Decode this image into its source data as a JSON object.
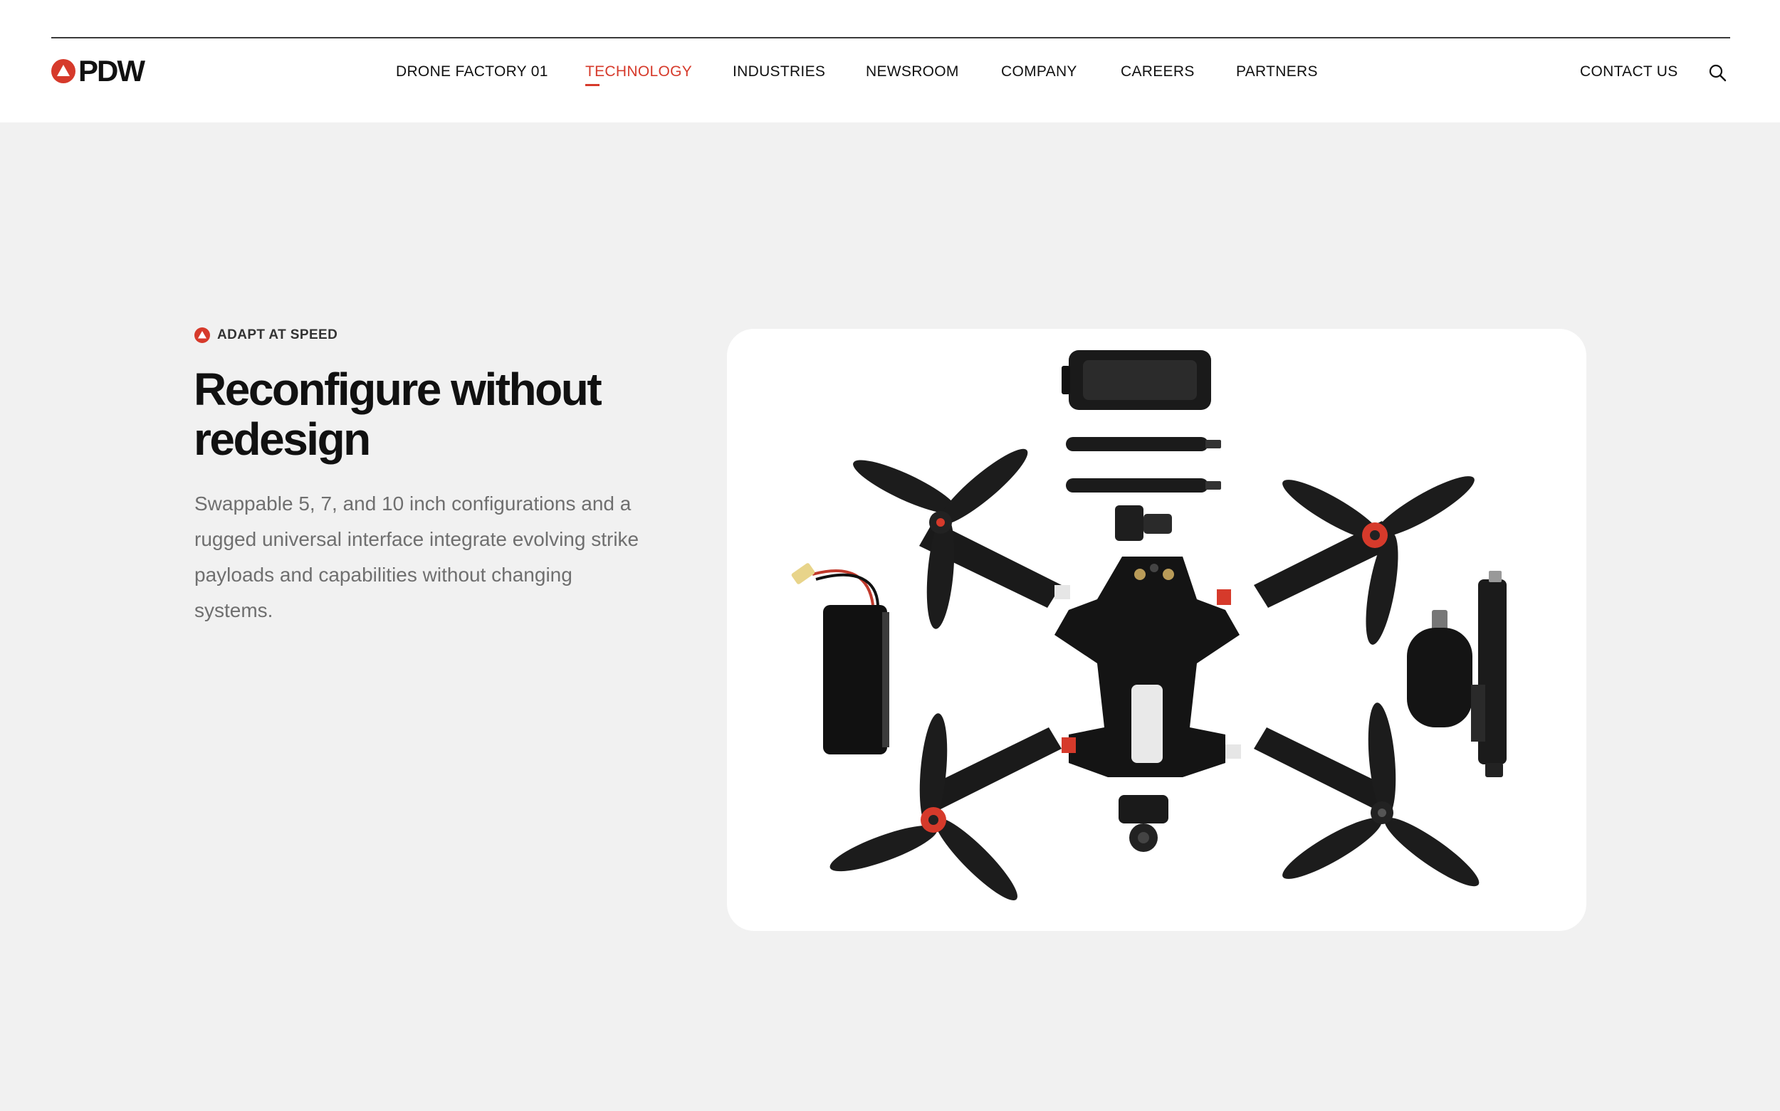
{
  "brand": {
    "name": "PDW",
    "accent": "#d63a2b",
    "logo_icon": "triangle-in-circle-icon"
  },
  "nav": {
    "items": [
      {
        "label": "DRONE FACTORY 01",
        "active": false
      },
      {
        "label": "TECHNOLOGY",
        "active": true
      },
      {
        "label": "INDUSTRIES",
        "active": false
      },
      {
        "label": "NEWSROOM",
        "active": false
      },
      {
        "label": "COMPANY",
        "active": false
      },
      {
        "label": "CAREERS",
        "active": false
      },
      {
        "label": "PARTNERS",
        "active": false
      }
    ],
    "contact_label": "CONTACT US",
    "search_icon": "search-icon"
  },
  "hero": {
    "eyebrow": "ADAPT AT SPEED",
    "eyebrow_icon": "triangle-in-circle-icon",
    "title": "Reconfigure without redesign",
    "body": "Swappable 5, 7, and 10 inch configurations and a rugged universal interface integrate evolving strike payloads and capabilities without changing systems.",
    "image": "modular-drone-parts-photo"
  },
  "colors": {
    "page_background": "#f1f1f1",
    "header_background": "#ffffff",
    "text_muted": "#6f6f6f"
  }
}
